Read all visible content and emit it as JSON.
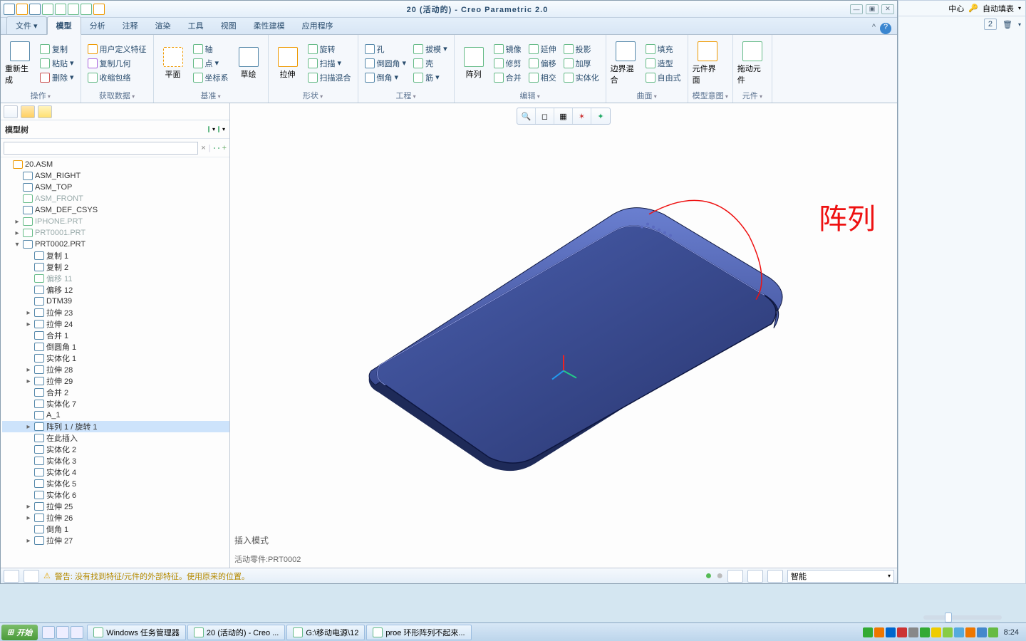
{
  "title": "20 (活动的) - Creo Parametric 2.0",
  "file_tab": "文件",
  "tabs": [
    "模型",
    "分析",
    "注释",
    "渲染",
    "工具",
    "视图",
    "柔性建模",
    "应用程序"
  ],
  "ribbon": {
    "op": {
      "label": "操作",
      "regen": "重新生成",
      "copy": "复制",
      "paste": "粘贴",
      "delete": "删除"
    },
    "get": {
      "label": "获取数据",
      "udf": "用户定义特征",
      "copygeom": "复制几何",
      "shrink": "收缩包络"
    },
    "datum": {
      "label": "基准",
      "plane": "平面",
      "sketch": "草绘",
      "axis": "轴",
      "point": "点",
      "csys": "坐标系"
    },
    "shape": {
      "label": "形状",
      "extrude": "拉伸",
      "revolve": "旋转",
      "sweep": "扫描",
      "blend": "扫描混合"
    },
    "eng": {
      "label": "工程",
      "hole": "孔",
      "round": "倒圆角",
      "chamfer": "倒角",
      "draft": "拔模",
      "shell": "壳",
      "rib": "筋"
    },
    "edit": {
      "label": "编辑",
      "pattern": "阵列",
      "mirror": "镜像",
      "trim": "修剪",
      "merge": "合并",
      "extend": "延伸",
      "offset": "偏移",
      "intersect": "相交",
      "project": "投影",
      "thicken": "加厚",
      "solidify": "实体化"
    },
    "surf": {
      "label": "曲面",
      "bnd": "边界混合",
      "fill": "填充",
      "style": "造型",
      "free": "自由式"
    },
    "intent": {
      "label": "模型意图",
      "comp": "元件界面"
    },
    "comp": {
      "label": "元件",
      "drag": "拖动元件"
    }
  },
  "tree": {
    "header": "模型树",
    "root": "20.ASM",
    "items": [
      {
        "t": "ASM_RIGHT",
        "i": 1
      },
      {
        "t": "ASM_TOP",
        "i": 1
      },
      {
        "t": "ASM_FRONT",
        "i": 1,
        "g": true
      },
      {
        "t": "ASM_DEF_CSYS",
        "i": 1
      },
      {
        "t": "IPHONE.PRT",
        "i": 1,
        "g": true,
        "exp": "▸"
      },
      {
        "t": "PRT0001.PRT",
        "i": 1,
        "g": true,
        "exp": "▸"
      },
      {
        "t": "PRT0002.PRT",
        "i": 1,
        "exp": "▾"
      },
      {
        "t": "复制 1",
        "i": 2
      },
      {
        "t": "复制 2",
        "i": 2
      },
      {
        "t": "偏移 11",
        "i": 2,
        "g": true
      },
      {
        "t": "偏移 12",
        "i": 2
      },
      {
        "t": "DTM39",
        "i": 2
      },
      {
        "t": "拉伸 23",
        "i": 2,
        "exp": "▸"
      },
      {
        "t": "拉伸 24",
        "i": 2,
        "exp": "▸"
      },
      {
        "t": "合并 1",
        "i": 2
      },
      {
        "t": "倒圆角 1",
        "i": 2
      },
      {
        "t": "实体化 1",
        "i": 2
      },
      {
        "t": "拉伸 28",
        "i": 2,
        "exp": "▸"
      },
      {
        "t": "拉伸 29",
        "i": 2,
        "exp": "▸"
      },
      {
        "t": "合并 2",
        "i": 2
      },
      {
        "t": "实体化 7",
        "i": 2
      },
      {
        "t": "A_1",
        "i": 2
      },
      {
        "t": "阵列 1 / 旋转 1",
        "i": 2,
        "exp": "▸",
        "sel": true
      },
      {
        "t": "在此插入",
        "i": 2
      },
      {
        "t": "实体化 2",
        "i": 2
      },
      {
        "t": "实体化 3",
        "i": 2
      },
      {
        "t": "实体化 4",
        "i": 2
      },
      {
        "t": "实体化 5",
        "i": 2
      },
      {
        "t": "实体化 6",
        "i": 2
      },
      {
        "t": "拉伸 25",
        "i": 2,
        "exp": "▸"
      },
      {
        "t": "拉伸 26",
        "i": 2,
        "exp": "▸"
      },
      {
        "t": "倒角 1",
        "i": 2
      },
      {
        "t": "拉伸 27",
        "i": 2,
        "exp": "▸"
      }
    ]
  },
  "viewport": {
    "insertmode": "插入模式",
    "activepart": "活动零件:PRT0002",
    "annotation": "阵列"
  },
  "status": {
    "warn": "警告: 没有找到特征/元件的外部特征。使用原来的位置。",
    "combo": "智能"
  },
  "rightpanel": {
    "center": "中心",
    "autofill": "自动填表",
    "badge": "2"
  },
  "taskbar": {
    "start": "开始",
    "tasks": [
      "Windows 任务管理器",
      "20 (活动的) - Creo ...",
      "G:\\移动电源\\12",
      "proe 环形阵列不起来..."
    ],
    "clock": "8:24"
  }
}
